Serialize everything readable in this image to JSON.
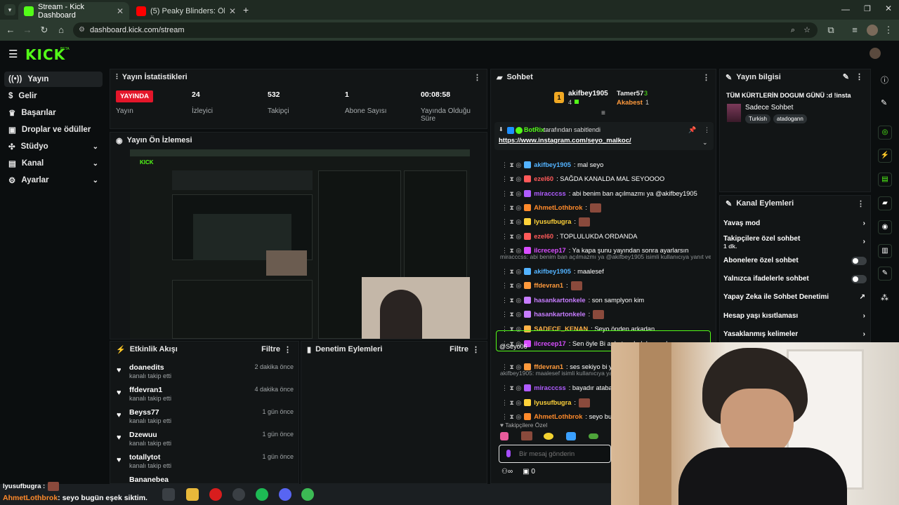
{
  "browser": {
    "tabs": [
      {
        "label": "Stream - Kick Dashboard",
        "active": true
      },
      {
        "label": "(5) Peaky Blinders: Ölümsüz Ad",
        "active": false
      }
    ],
    "url": "dashboard.kick.com/stream"
  },
  "brand": {
    "logo": "KICK",
    "accent": "#53fc18"
  },
  "sidebar": {
    "items": [
      {
        "label": "Yayın",
        "icon": "broadcast-icon",
        "active": true
      },
      {
        "label": "Gelir",
        "icon": "dollar-icon"
      },
      {
        "label": "Başarılar",
        "icon": "trophy-icon"
      },
      {
        "label": "Droplar ve ödüller",
        "icon": "gift-icon"
      },
      {
        "label": "Stüdyo",
        "icon": "studio-icon"
      },
      {
        "label": "Kanal",
        "icon": "channel-icon"
      },
      {
        "label": "Ayarlar",
        "icon": "gear-icon"
      }
    ]
  },
  "stats": {
    "title": "Yayın İstatistikleri",
    "live_badge": "YAYINDA",
    "items": [
      {
        "value": "24",
        "label": "İzleyici"
      },
      {
        "value": "532",
        "label": "Takipçi"
      },
      {
        "value": "1",
        "label": "Abone Sayısı"
      },
      {
        "value": "00:08:58",
        "label": "Yayında Olduğu Süre"
      }
    ],
    "first_label": "Yayın"
  },
  "preview": {
    "title": "Yayın Ön İzlemesi"
  },
  "activity": {
    "title": "Etkinlik Akışı",
    "filter": "Filtre",
    "items": [
      {
        "name": "doanedits",
        "sub": "kanalı takip etti",
        "time": "2 dakika önce"
      },
      {
        "name": "ffdevran1",
        "sub": "kanalı takip etti",
        "time": "4 dakika önce"
      },
      {
        "name": "Beyss77",
        "sub": "kanalı takip etti",
        "time": "1 gün önce"
      },
      {
        "name": "Dzewuu",
        "sub": "kanalı takip etti",
        "time": "1 gün önce"
      },
      {
        "name": "totallytot",
        "sub": "kanalı takip etti",
        "time": "1 gün önce"
      },
      {
        "name": "Bananebea",
        "sub": "",
        "time": ""
      }
    ]
  },
  "moderation": {
    "title": "Denetim Eylemleri",
    "filter": "Filtre"
  },
  "chat": {
    "title": "Sohbet",
    "leader1": {
      "name": "akifbey1905",
      "count": "4"
    },
    "leader2": {
      "name": "Tamer57",
      "count": "3"
    },
    "leader3": {
      "name": "Akabest",
      "count": "1"
    },
    "pinned_by": "BotRix",
    "pinned_suffix": "tarafından sabitlendi",
    "pinned_link": "https://www.instagram.com/seyo_malkoc/",
    "messages": [
      {
        "user": "akifbey1905",
        "color": "#53b3ff",
        "text": ": mal seyo"
      },
      {
        "user": "ezel60",
        "color": "#ff5a5a",
        "text": ": SAĞDA KANALDA MAL SEYOOOO"
      },
      {
        "user": "miracccss",
        "color": "#b05cff",
        "text": ": abi benim ban açılmazmı ya @akifbey1905"
      },
      {
        "user": "AhmetLothbrok",
        "color": "#ff8a2b",
        "text": ":",
        "emote": true
      },
      {
        "user": "lyusufbugra",
        "color": "#ffd23a",
        "text": ":",
        "emote": true
      },
      {
        "user": "ezel60",
        "color": "#ff5a5a",
        "text": ": TOPLULUKDA ORDANDA"
      },
      {
        "user": "ilcrecep17",
        "color": "#d84dff",
        "text": ": Ya kapa şunu yayından sonra ayarlarsın"
      },
      {
        "user": "akifbey1905",
        "color": "#53b3ff",
        "text": ": maalesef"
      },
      {
        "user": "ffdevran1",
        "color": "#ff9a3c",
        "text": ":",
        "emote": true
      },
      {
        "user": "hasankartonkele",
        "color": "#c77dff",
        "text": ": son samplyon kim"
      },
      {
        "user": "hasankartonkele",
        "color": "#c77dff",
        "text": ":",
        "emote": true
      },
      {
        "user": "SADECE_KENAN",
        "color": "#ffb347",
        "text": ": Seyo önden arkadan"
      },
      {
        "user": "ilcrecep17",
        "color": "#d84dff",
        "text": ": Sen öyle Bi anket aç bak ben nabıyoruz sana"
      },
      {
        "user": "ffdevran1",
        "color": "#ff9a3c",
        "text": ": ses sekiyo bi yerden"
      },
      {
        "user": "miracccss",
        "color": "#b05cff",
        "text": ": bayadır ataban"
      },
      {
        "user": "lyusufbugra",
        "color": "#ffd23a",
        "text": ":",
        "emote": true
      },
      {
        "user": "AhmetLothbrok",
        "color": "#ff8a2b",
        "text": ": seyo bugün eş"
      }
    ],
    "reply1": "miracccss: abi benim ban açılmazmı ya @akifbey1905 isimli kullanıcıya yanıt veriyor",
    "reply2": "akifbey1905: maalesef isimli kullanıcıya yan",
    "highlight_tail": "@Seyo06",
    "followers_only": "Takipçilere Özel",
    "input_placeholder": "Bir mesaj gönderin",
    "points": "0",
    "infinity": "∞"
  },
  "stream_info": {
    "title": "Yayın bilgisi",
    "stream_title": "TÜM KÜRTLERİN DOGUM GÜNÜ :d !insta",
    "category": "Sadece Sohbet",
    "tags": [
      "Turkish",
      "atadogann"
    ]
  },
  "channel_actions": {
    "title": "Kanal Eylemleri",
    "items": [
      {
        "label": "Yavaş mod",
        "control": "chevron"
      },
      {
        "label": "Takipçilere özel sohbet",
        "sub": "1 dk.",
        "control": "chevron"
      },
      {
        "label": "Abonelere özel sohbet",
        "control": "toggle"
      },
      {
        "label": "Yalnızca ifadelerle sohbet",
        "control": "toggle"
      },
      {
        "label": "Yapay Zeka ile Sohbet Denetimi",
        "control": "external"
      },
      {
        "label": "Hesap yaşı kısıtlaması",
        "control": "chevron"
      },
      {
        "label": "Yasaklanmış kelimeler",
        "control": "chevron"
      }
    ]
  },
  "overlay_chat": {
    "line1_user": "lyusufbugra :",
    "line2_user": "AhmetLothbrok",
    "line2_text": ": seyo bugün eşek siktim."
  }
}
